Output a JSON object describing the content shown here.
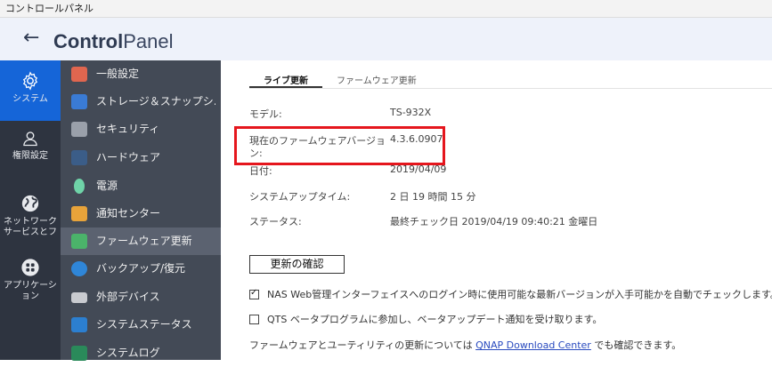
{
  "window": {
    "title": "コントロールパネル"
  },
  "header": {
    "back": "←",
    "brand_bold": "Control",
    "brand_rest": "Panel"
  },
  "rail": [
    {
      "label": "システム",
      "icon": "gear-icon"
    },
    {
      "label": "権限設定",
      "icon": "user-icon"
    },
    {
      "label": "ネットワーク サービスとフ",
      "icon": "globe-icon"
    },
    {
      "label": "アプリケーション",
      "icon": "apps-icon"
    }
  ],
  "menu": [
    {
      "label": "一般設定",
      "icon": "general-settings-icon",
      "color": "#e0664f"
    },
    {
      "label": "ストレージ＆スナップシ...",
      "icon": "storage-icon",
      "color": "#3a7bd5"
    },
    {
      "label": "セキュリティ",
      "icon": "lock-icon",
      "color": "#9aa0aa"
    },
    {
      "label": "ハードウェア",
      "icon": "hardware-icon",
      "color": "#3b5d88"
    },
    {
      "label": "電源",
      "icon": "power-icon",
      "color": "#6fd3a8"
    },
    {
      "label": "通知センター",
      "icon": "notification-icon",
      "color": "#e8a33a"
    },
    {
      "label": "ファームウェア更新",
      "icon": "firmware-icon",
      "color": "#4bb36a"
    },
    {
      "label": "バックアップ/復元",
      "icon": "backup-icon",
      "color": "#2f86d8"
    },
    {
      "label": "外部デバイス",
      "icon": "external-device-icon",
      "color": "#c9cbd0"
    },
    {
      "label": "システムステータス",
      "icon": "system-status-icon",
      "color": "#2c7fd0"
    },
    {
      "label": "システムログ",
      "icon": "log-icon",
      "color": "#2a8a5a"
    }
  ],
  "tabs": [
    "ライブ更新",
    "ファームウェア更新"
  ],
  "info": {
    "model_label": "モデル:",
    "model_value": "TS-932X",
    "fw_label_1": "現在のファームウェアバージョ",
    "fw_label_2": "ン:",
    "fw_value": "4.3.6.0907",
    "date_label": "日付:",
    "date_value": "2019/04/09",
    "uptime_label": "システムアップタイム:",
    "uptime_value": "2 日 19 時間 15 分",
    "status_label": "ステータス:",
    "status_value": "最終チェック日 2019/04/19 09:40:21 金曜日"
  },
  "check_button": "更新の確認",
  "options": {
    "auto_check": "NAS Web管理インターフェイスへのログイン時に使用可能な最新バージョンが入手可能かを自動でチェックします。",
    "beta": "QTS ベータプログラムに参加し、ベータアップデート通知を受け取ります。"
  },
  "footer": {
    "before": "ファームウェアとユーティリティの更新については",
    "link": "QNAP Download Center",
    "after": "でも確認できます。"
  },
  "colors": {
    "accent": "#1565d8",
    "highlight": "#e5161d"
  }
}
